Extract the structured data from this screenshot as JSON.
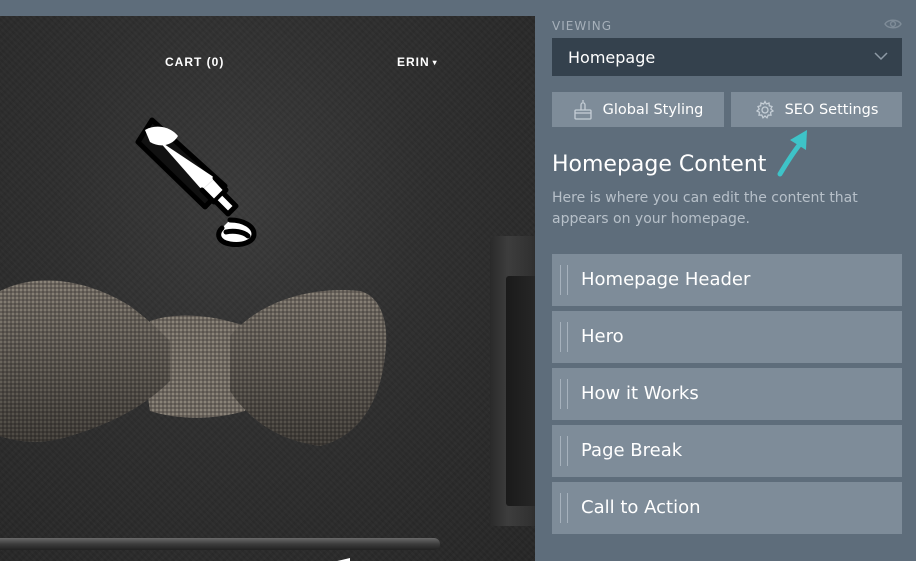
{
  "preview": {
    "nav": {
      "cart_label": "CART (0)",
      "user_label": "ERIN",
      "user_caret": "▾"
    }
  },
  "sidebar": {
    "viewing_label": "VIEWING",
    "viewing_selected": "Homepage",
    "global_styling_label": "Global Styling",
    "seo_settings_label": "SEO Settings",
    "content_title": "Homepage Content",
    "content_description": "Here is where you can edit the content that appears on your homepage.",
    "sections": [
      {
        "label": "Homepage Header"
      },
      {
        "label": "Hero"
      },
      {
        "label": "How it Works"
      },
      {
        "label": "Page Break"
      },
      {
        "label": "Call to Action"
      }
    ]
  },
  "colors": {
    "sidebar_bg": "#5e6d7b",
    "select_bg": "#34414d",
    "item_bg": "#7e8c99",
    "accent_arrow": "#3ec3c8"
  },
  "icons": [
    "eye-icon",
    "chevron-down-icon",
    "brush-icon",
    "gear-icon",
    "arrow-pointer-icon",
    "drag-handle-icon"
  ]
}
